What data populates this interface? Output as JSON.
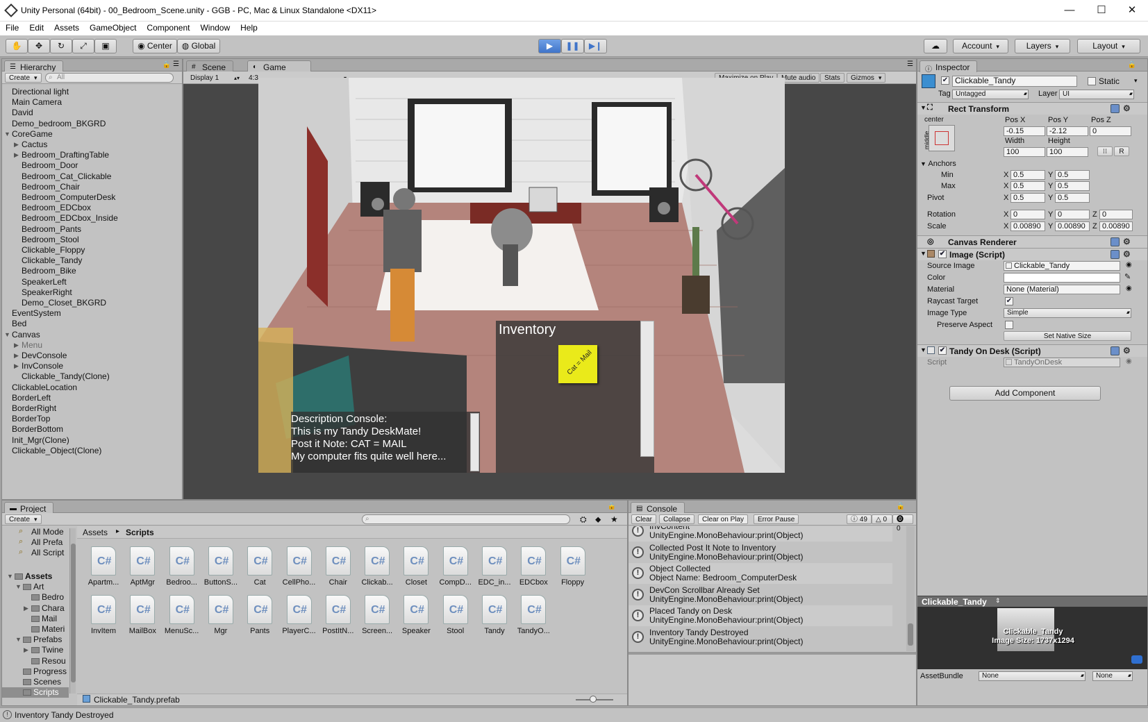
{
  "window": {
    "title": "Unity Personal (64bit) - 00_Bedroom_Scene.unity - GGB - PC, Mac & Linux Standalone <DX11>",
    "minimize": "—",
    "maximize": "☐",
    "close": "✕"
  },
  "menu": [
    "File",
    "Edit",
    "Assets",
    "GameObject",
    "Component",
    "Window",
    "Help"
  ],
  "toolbar": {
    "pivot": "Center",
    "space": "Global",
    "account": "Account",
    "layers": "Layers",
    "layout": "Layout",
    "tools": [
      "hand-icon",
      "move-icon",
      "rotate-icon",
      "scale-icon",
      "rect-icon"
    ],
    "play_state": "playing"
  },
  "hierarchy": {
    "tab": "Hierarchy",
    "create": "Create",
    "search_placeholder": "All",
    "items": [
      {
        "label": "Directional light",
        "indent": 0,
        "arrow": ""
      },
      {
        "label": "Main Camera",
        "indent": 0,
        "arrow": ""
      },
      {
        "label": "David",
        "indent": 0,
        "arrow": ""
      },
      {
        "label": "Demo_bedroom_BKGRD",
        "indent": 0,
        "arrow": ""
      },
      {
        "label": "CoreGame",
        "indent": 0,
        "arrow": "▼"
      },
      {
        "label": "Cactus",
        "indent": 1,
        "arrow": "▶"
      },
      {
        "label": "Bedroom_DraftingTable",
        "indent": 1,
        "arrow": "▶"
      },
      {
        "label": "Bedroom_Door",
        "indent": 1,
        "arrow": ""
      },
      {
        "label": "Bedroom_Cat_Clickable",
        "indent": 1,
        "arrow": ""
      },
      {
        "label": "Bedroom_Chair",
        "indent": 1,
        "arrow": ""
      },
      {
        "label": "Bedroom_ComputerDesk",
        "indent": 1,
        "arrow": ""
      },
      {
        "label": "Bedroom_EDCbox",
        "indent": 1,
        "arrow": ""
      },
      {
        "label": "Bedroom_EDCbox_Inside",
        "indent": 1,
        "arrow": ""
      },
      {
        "label": "Bedroom_Pants",
        "indent": 1,
        "arrow": ""
      },
      {
        "label": "Bedroom_Stool",
        "indent": 1,
        "arrow": ""
      },
      {
        "label": "Clickable_Floppy",
        "indent": 1,
        "arrow": ""
      },
      {
        "label": "Clickable_Tandy",
        "indent": 1,
        "arrow": ""
      },
      {
        "label": "Bedroom_Bike",
        "indent": 1,
        "arrow": ""
      },
      {
        "label": "SpeakerLeft",
        "indent": 1,
        "arrow": ""
      },
      {
        "label": "SpeakerRight",
        "indent": 1,
        "arrow": ""
      },
      {
        "label": "Demo_Closet_BKGRD",
        "indent": 1,
        "arrow": ""
      },
      {
        "label": "EventSystem",
        "indent": 0,
        "arrow": ""
      },
      {
        "label": "Bed",
        "indent": 0,
        "arrow": ""
      },
      {
        "label": "Canvas",
        "indent": 0,
        "arrow": "▼"
      },
      {
        "label": "Menu",
        "indent": 1,
        "arrow": "▶",
        "disabled": true
      },
      {
        "label": "DevConsole",
        "indent": 1,
        "arrow": "▶"
      },
      {
        "label": "InvConsole",
        "indent": 1,
        "arrow": "▶"
      },
      {
        "label": "Clickable_Tandy(Clone)",
        "indent": 1,
        "arrow": ""
      },
      {
        "label": "ClickableLocation",
        "indent": 0,
        "arrow": ""
      },
      {
        "label": "BorderLeft",
        "indent": 0,
        "arrow": ""
      },
      {
        "label": "BorderRight",
        "indent": 0,
        "arrow": ""
      },
      {
        "label": "BorderTop",
        "indent": 0,
        "arrow": ""
      },
      {
        "label": "BorderBottom",
        "indent": 0,
        "arrow": ""
      },
      {
        "label": "Init_Mgr(Clone)",
        "indent": 0,
        "arrow": ""
      },
      {
        "label": "Clickable_Object(Clone)",
        "indent": 0,
        "arrow": ""
      }
    ]
  },
  "scene_tab": "Scene",
  "game": {
    "tab": "Game",
    "display": "Display 1",
    "aspect": "4:3",
    "maximize_on_play": "Maximize on Play",
    "mute_audio": "Mute audio",
    "stats": "Stats",
    "gizmos": "Gizmos",
    "inventory_title": "Inventory",
    "sticky_note": "Cat = Mail",
    "description_lines": [
      "Description Console:",
      "This is my Tandy DeskMate!",
      "Post it Note: CAT = MAIL",
      "My computer fits quite well here..."
    ]
  },
  "inspector": {
    "tab": "Inspector",
    "object_name": "Clickable_Tandy",
    "static_label": "Static",
    "tag_label": "Tag",
    "tag_value": "Untagged",
    "layer_label": "Layer",
    "layer_value": "UI",
    "rect_transform": "Rect Transform",
    "anchor_h": "center",
    "anchor_v": "middle",
    "pos_x_label": "Pos X",
    "pos_y_label": "Pos Y",
    "pos_z_label": "Pos Z",
    "pos_x": "-0.15",
    "pos_y": "-2.12",
    "pos_z": "0",
    "width_label": "Width",
    "height_label": "Height",
    "width": "100",
    "height": "100",
    "r_label": "R",
    "anchors_label": "Anchors",
    "min_label": "Min",
    "max_label": "Max",
    "pivot_label": "Pivot",
    "x_label": "X",
    "y_label": "Y",
    "z_label": "Z",
    "min_x": "0.5",
    "min_y": "0.5",
    "max_x": "0.5",
    "max_y": "0.5",
    "pivot_x": "0.5",
    "pivot_y": "0.5",
    "rotation_label": "Rotation",
    "rot_x": "0",
    "rot_y": "0",
    "rot_z": "0",
    "scale_label": "Scale",
    "scale_x": "0.00890",
    "scale_y": "0.00890",
    "scale_z": "0.00890",
    "canvas_renderer": "Canvas Renderer",
    "image_script": "Image (Script)",
    "source_image_label": "Source Image",
    "source_image": "Clickable_Tandy",
    "color_label": "Color",
    "material_label": "Material",
    "material": "None (Material)",
    "raycast_label": "Raycast Target",
    "image_type_label": "Image Type",
    "image_type": "Simple",
    "preserve_aspect_label": "Preserve Aspect",
    "set_native_size": "Set Native Size",
    "tandy_script": "Tandy On Desk (Script)",
    "script_label": "Script",
    "script_value": "TandyOnDesk",
    "add_component": "Add Component",
    "preview_title": "Clickable_Tandy",
    "preview_name": "Clickable_Tandy",
    "preview_size": "Image Size: 1737x1294",
    "assetbundle_label": "AssetBundle",
    "assetbundle_value": "None",
    "assetbundle_variant": "None"
  },
  "project": {
    "tab": "Project",
    "create": "Create",
    "favorites": [
      "All Mode",
      "All Prefa",
      "All Script"
    ],
    "tree": [
      {
        "label": "Assets",
        "indent": 0,
        "arrow": "▼",
        "bold": true
      },
      {
        "label": "Art",
        "indent": 1,
        "arrow": "▼"
      },
      {
        "label": "Bedro",
        "indent": 2,
        "arrow": ""
      },
      {
        "label": "Chara",
        "indent": 2,
        "arrow": "▶"
      },
      {
        "label": "Mail",
        "indent": 2,
        "arrow": ""
      },
      {
        "label": "Materi",
        "indent": 2,
        "arrow": ""
      },
      {
        "label": "Prefabs",
        "indent": 1,
        "arrow": "▼"
      },
      {
        "label": "Twine",
        "indent": 2,
        "arrow": "▶"
      },
      {
        "label": "Resou",
        "indent": 2,
        "arrow": ""
      },
      {
        "label": "Progress",
        "indent": 1,
        "arrow": ""
      },
      {
        "label": "Scenes",
        "indent": 1,
        "arrow": ""
      },
      {
        "label": "Scripts",
        "indent": 1,
        "arrow": "",
        "selected": true
      }
    ],
    "breadcrumb_root": "Assets",
    "breadcrumb_sep": "▸",
    "breadcrumb_current": "Scripts",
    "files_row1": [
      "Apartm...",
      "AptMgr",
      "Bedroo...",
      "ButtonS...",
      "Cat",
      "CellPho...",
      "Chair",
      "Clickab...",
      "Closet",
      "CompD...",
      "EDC_in...",
      "EDCbox",
      "Floppy"
    ],
    "files_row2": [
      "InvItem",
      "MailBox",
      "MenuSc...",
      "Mgr",
      "Pants",
      "PlayerC...",
      "PostItN...",
      "Screen...",
      "Speaker",
      "Stool",
      "Tandy",
      "TandyO..."
    ],
    "file_glyph": "C#",
    "selected_asset": "Clickable_Tandy.prefab"
  },
  "console": {
    "tab": "Console",
    "buttons": [
      "Clear",
      "Collapse",
      "Clear on Play",
      "Error Pause"
    ],
    "info_count": "49",
    "warn_count": "0",
    "error_count": "0",
    "entries": [
      {
        "line1": "InvContent",
        "line2": "UnityEngine.MonoBehaviour:print(Object)"
      },
      {
        "line1": "Collected Post It Note to Inventory",
        "line2": "UnityEngine.MonoBehaviour:print(Object)"
      },
      {
        "line1": "Object Collected",
        "line2": "Object Name: Bedroom_ComputerDesk"
      },
      {
        "line1": "DevCon Scrollbar Already Set",
        "line2": "UnityEngine.MonoBehaviour:print(Object)"
      },
      {
        "line1": "Placed Tandy on Desk",
        "line2": "UnityEngine.MonoBehaviour:print(Object)"
      },
      {
        "line1": "Inventory Tandy Destroyed",
        "line2": "UnityEngine.MonoBehaviour:print(Object)"
      }
    ]
  },
  "status_bar": "Inventory Tandy Destroyed",
  "colors": {
    "play_blue": "#3f74c9",
    "panel_bg": "#c2c2c2",
    "game_bg": "#474747",
    "sticky": "#eaea1a"
  }
}
